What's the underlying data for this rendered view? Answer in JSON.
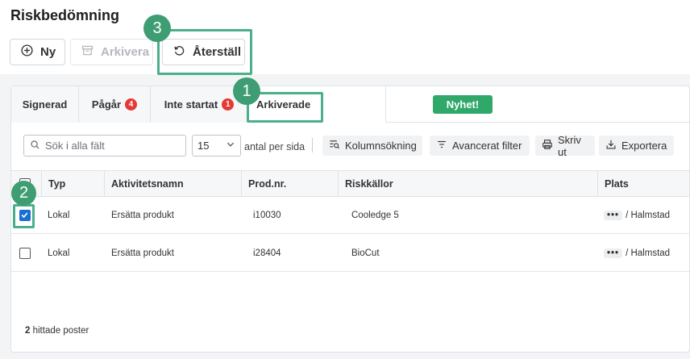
{
  "page": {
    "title": "Riskbedömning"
  },
  "toolbar": {
    "new_label": "Ny",
    "archive_label": "Arkivera",
    "restore_label": "Återställ"
  },
  "tabs": [
    {
      "label": "Signerad",
      "count": ""
    },
    {
      "label": "Pågår",
      "count": "4"
    },
    {
      "label": "Inte startat",
      "count": "1"
    },
    {
      "label": "Arkiverade",
      "count": ""
    }
  ],
  "new_chip": "Nyhet!",
  "search": {
    "placeholder": "Sök i alla fält"
  },
  "per_page": {
    "value": "15",
    "label": "antal per sida"
  },
  "tools": {
    "column_search": "Kolumnsökning",
    "advanced_filter": "Avancerat filter",
    "print": "Skriv ut",
    "export": "Exportera"
  },
  "columns": {
    "type": "Typ",
    "activity": "Aktivitetsnamn",
    "prod": "Prod.nr.",
    "risk": "Riskkällor",
    "place": "Plats"
  },
  "rows": [
    {
      "checked": true,
      "type": "Lokal",
      "activity": "Ersätta produkt",
      "prod": "i10030",
      "risk": "Cooledge 5",
      "dots": "•••",
      "place": "/ Halmstad"
    },
    {
      "checked": false,
      "type": "Lokal",
      "activity": "Ersätta produkt",
      "prod": "i28404",
      "risk": "BioCut",
      "dots": "•••",
      "place": "/ Halmstad"
    }
  ],
  "footer": {
    "count": "2",
    "text": "hittade poster"
  },
  "callouts": {
    "one": "1",
    "two": "2",
    "three": "3"
  },
  "colors": {
    "accent_green": "#3f9d73",
    "callout_border": "#4caf8a",
    "badge_red": "#e53935",
    "chip_green": "#2fa86a",
    "checkbox_blue": "#1a6fd1"
  }
}
